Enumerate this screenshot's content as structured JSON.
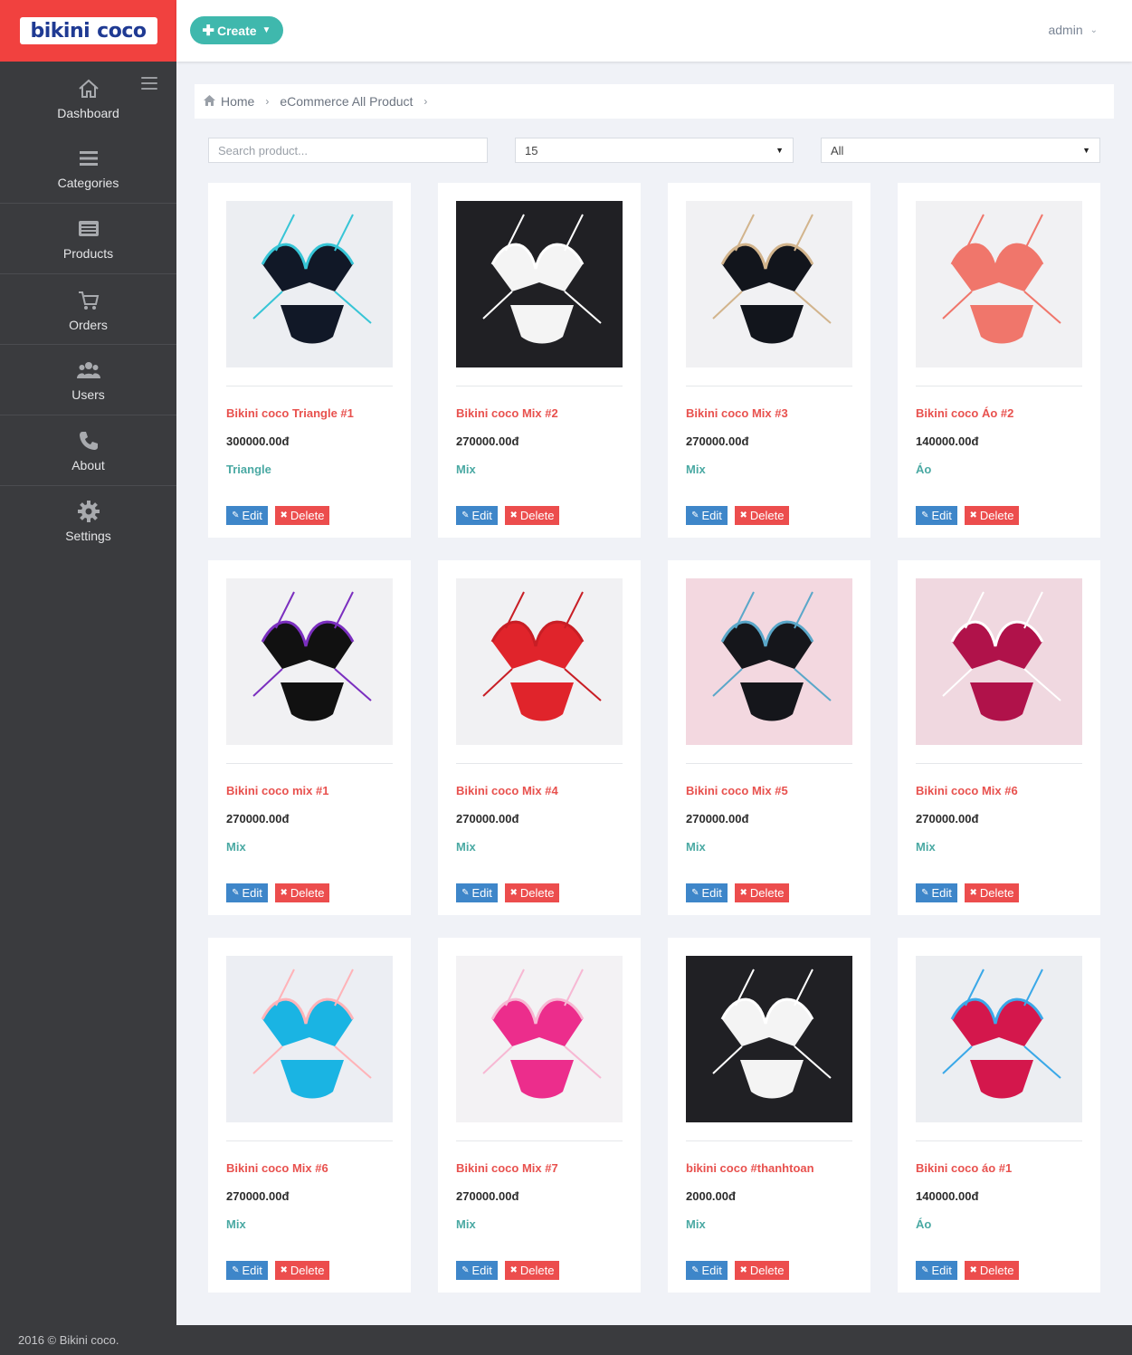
{
  "brand": {
    "word1": "bikini",
    "word2": "coco"
  },
  "topbar": {
    "create_label": "Create",
    "user_label": "admin"
  },
  "sidebar": {
    "items": [
      {
        "label": "Dashboard",
        "icon": "home-icon"
      },
      {
        "label": "Categories",
        "icon": "list-icon"
      },
      {
        "label": "Products",
        "icon": "product-list-icon"
      },
      {
        "label": "Orders",
        "icon": "cart-icon"
      },
      {
        "label": "Users",
        "icon": "users-icon"
      },
      {
        "label": "About",
        "icon": "phone-icon"
      },
      {
        "label": "Settings",
        "icon": "gear-icon"
      }
    ]
  },
  "breadcrumb": {
    "home": "Home",
    "current": "eCommerce All Product"
  },
  "filters": {
    "search_placeholder": "Search product...",
    "per_page": "15",
    "category": "All"
  },
  "actions": {
    "edit": "Edit",
    "delete": "Delete"
  },
  "products": [
    {
      "name": "Bikini coco Triangle #1",
      "price": "300000.00đ",
      "category": "Triangle",
      "bg": "#eceef2",
      "c1": "#111827",
      "c2": "#37c5d6"
    },
    {
      "name": "Bikini coco Mix #2",
      "price": "270000.00đ",
      "category": "Mix",
      "bg": "#202024",
      "c1": "#f4f4f4",
      "c2": "#ffffff"
    },
    {
      "name": "Bikini coco Mix #3",
      "price": "270000.00đ",
      "category": "Mix",
      "bg": "#f1f1f3",
      "c1": "#12151c",
      "c2": "#d2b48c"
    },
    {
      "name": "Bikini coco Áo #2",
      "price": "140000.00đ",
      "category": "Áo",
      "bg": "#f1f1f3",
      "c1": "#f0766b",
      "c2": "#f0766b"
    },
    {
      "name": "Bikini coco mix #1",
      "price": "270000.00đ",
      "category": "Mix",
      "bg": "#f1f1f3",
      "c1": "#111111",
      "c2": "#7b2fbf"
    },
    {
      "name": "Bikini coco Mix #4",
      "price": "270000.00đ",
      "category": "Mix",
      "bg": "#f1f1f3",
      "c1": "#e0242b",
      "c2": "#c81e25"
    },
    {
      "name": "Bikini coco Mix #5",
      "price": "270000.00đ",
      "category": "Mix",
      "bg": "#f3d8e0",
      "c1": "#15161b",
      "c2": "#5aa7c9"
    },
    {
      "name": "Bikini coco Mix #6",
      "price": "270000.00đ",
      "category": "Mix",
      "bg": "#f0d8e0",
      "c1": "#b0124a",
      "c2": "#ffffff"
    },
    {
      "name": "Bikini coco Mix #6",
      "price": "270000.00đ",
      "category": "Mix",
      "bg": "#eceef3",
      "c1": "#1ab4e3",
      "c2": "#ffb3b8"
    },
    {
      "name": "Bikini coco Mix #7",
      "price": "270000.00đ",
      "category": "Mix",
      "bg": "#f3f2f4",
      "c1": "#ec2d8c",
      "c2": "#f7b8d3"
    },
    {
      "name": "bikini coco #thanhtoan",
      "price": "2000.00đ",
      "category": "Mix",
      "bg": "#202024",
      "c1": "#f4f4f4",
      "c2": "#ffffff"
    },
    {
      "name": "Bikini coco áo #1",
      "price": "140000.00đ",
      "category": "Áo",
      "bg": "#eceef2",
      "c1": "#d4174c",
      "c2": "#3aa8e8"
    }
  ],
  "footer": {
    "text": "2016 © Bikini coco."
  }
}
